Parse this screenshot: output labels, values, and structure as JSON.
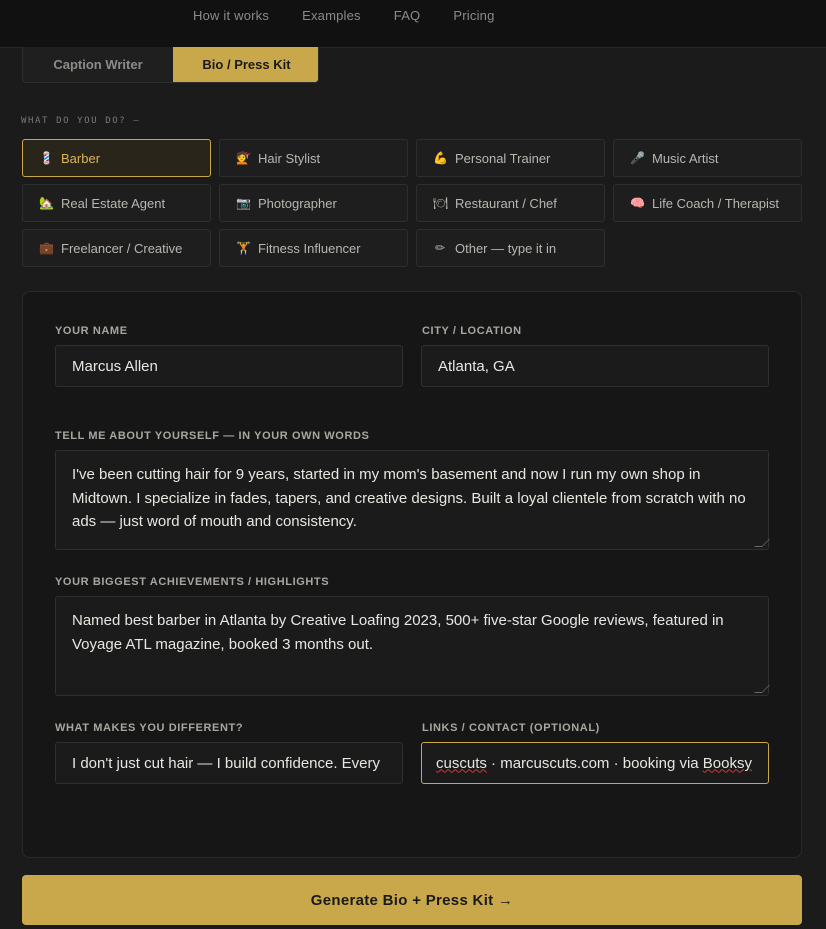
{
  "nav": {
    "links": [
      "How it works",
      "Examples",
      "FAQ",
      "Pricing"
    ]
  },
  "tabs": [
    {
      "label": "Caption Writer",
      "active": false
    },
    {
      "label": "Bio / Press Kit",
      "active": true
    }
  ],
  "section_label": "WHAT DO YOU DO? —",
  "professions": [
    {
      "icon": "💈",
      "icon_name": "barber-pole-icon",
      "label": "Barber",
      "active": true
    },
    {
      "icon": "💇",
      "icon_name": "haircut-icon",
      "label": "Hair Stylist"
    },
    {
      "icon": "💪",
      "icon_name": "flexed-biceps-icon",
      "label": "Personal Trainer"
    },
    {
      "icon": "🎤",
      "icon_name": "microphone-icon",
      "label": "Music Artist"
    },
    {
      "icon": "🏡",
      "icon_name": "house-icon",
      "label": "Real Estate Agent"
    },
    {
      "icon": "📷",
      "icon_name": "camera-icon",
      "label": "Photographer"
    },
    {
      "icon": "🍽",
      "icon_name": "plate-icon",
      "label": "Restaurant / Chef"
    },
    {
      "icon": "🧠",
      "icon_name": "brain-icon",
      "label": "Life Coach / Therapist"
    },
    {
      "icon": "💼",
      "icon_name": "briefcase-icon",
      "label": "Freelancer / Creative"
    },
    {
      "icon": "🏋",
      "icon_name": "weightlifter-icon",
      "label": "Fitness Influencer"
    },
    {
      "icon": "✏",
      "icon_name": "pencil-icon",
      "label": "Other — type it in"
    }
  ],
  "form": {
    "name": {
      "label": "YOUR NAME",
      "value": "Marcus Allen"
    },
    "city": {
      "label": "CITY / LOCATION",
      "value": "Atlanta, GA"
    },
    "about": {
      "label": "TELL ME ABOUT YOURSELF — IN YOUR OWN WORDS",
      "value": "I've been cutting hair for 9 years, started in my mom's basement and now I run my own shop in Midtown. I specialize in fades, tapers, and creative designs. Built a loyal clientele from scratch with no ads — just word of mouth and consistency."
    },
    "achievements": {
      "label": "YOUR BIGGEST ACHIEVEMENTS / HIGHLIGHTS",
      "value": "Named best barber in Atlanta by Creative Loafing 2023, 500+ five-star Google reviews, featured in Voyage ATL magazine, booked 3 months out."
    },
    "different": {
      "label": "WHAT MAKES YOU DIFFERENT?",
      "value": "I don't just cut hair — I build confidence. Every"
    },
    "links": {
      "label": "LINKS / CONTACT (OPTIONAL)",
      "value_part1": "cuscuts",
      "value_part2": " · marcuscuts.com · booking via ",
      "value_part3": "Booksy"
    }
  },
  "cta_label": "Generate Bio + Press Kit →",
  "colors": {
    "accent": "#c9a84c",
    "background": "#1b1b1b",
    "card": "#161616"
  }
}
